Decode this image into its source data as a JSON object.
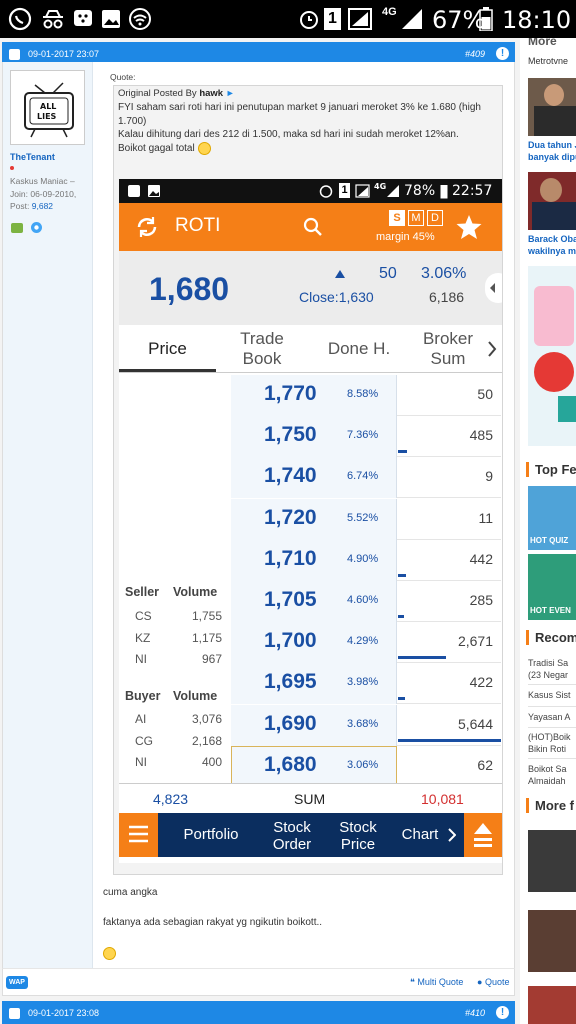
{
  "statusbar": {
    "battery_pct": "67%",
    "time": "18:10",
    "sim": "1",
    "net": "4G"
  },
  "post1": {
    "date": "09-01-2017 23:07",
    "number": "#409",
    "user": {
      "name": "TheTenant",
      "rank": "Kaskus Maniac",
      "join_label": "Join:",
      "join_date": "06-09-2010",
      "post_label": "Post:",
      "post_count": "9,682",
      "avatar_text_1": "ALL",
      "avatar_text_2": "LIES"
    },
    "quote_label": "Quote:",
    "quote_prefix": "Original Posted By",
    "quote_author": "hawk",
    "quote_lines": [
      "FYI saham sari roti hari ini penutupan market 9 januari meroket 3% ke 1.680 (high 1.700)",
      "Kalau dihitung dari des 212 di 1.500, maka sd hari ini sudah meroket 12%an.",
      "Boikot gagal total"
    ],
    "message_1": "cuma angka",
    "message_2": "faktanya ada sebagian rakyat yg ngikutin boikott..",
    "footer": {
      "multi_quote": "Multi Quote",
      "quote": "Quote",
      "wap": "WAP"
    }
  },
  "shot": {
    "status": {
      "sim": "1",
      "net": "4G",
      "battery": "78%",
      "time": "22:57"
    },
    "ticker": "ROTI",
    "period_tabs": [
      "S",
      "M",
      "D"
    ],
    "margin": "margin 45%",
    "last": "1,680",
    "change": "50",
    "change_pct": "3.06%",
    "close_label": "Close:",
    "close": "1,630",
    "volume": "6,186",
    "tabs": [
      {
        "line1": "Price",
        "line2": ""
      },
      {
        "line1": "Trade",
        "line2": "Book"
      },
      {
        "line1": "Done H.",
        "line2": ""
      },
      {
        "line1": "Broker",
        "line2": "Sum"
      }
    ],
    "orderbook": [
      {
        "price": "1,770",
        "pct": "8.58%",
        "vol": "50",
        "bar": 0.0
      },
      {
        "price": "1,750",
        "pct": "7.36%",
        "vol": "485",
        "bar": 0.09
      },
      {
        "price": "1,740",
        "pct": "6.74%",
        "vol": "9",
        "bar": 0.0
      },
      {
        "price": "1,720",
        "pct": "5.52%",
        "vol": "11",
        "bar": 0.0
      },
      {
        "price": "1,710",
        "pct": "4.90%",
        "vol": "442",
        "bar": 0.08
      },
      {
        "price": "1,705",
        "pct": "4.60%",
        "vol": "285",
        "bar": 0.05
      },
      {
        "price": "1,700",
        "pct": "4.29%",
        "vol": "2,671",
        "bar": 0.47
      },
      {
        "price": "1,695",
        "pct": "3.98%",
        "vol": "422",
        "bar": 0.07
      },
      {
        "price": "1,690",
        "pct": "3.68%",
        "vol": "5,644",
        "bar": 1.0
      },
      {
        "price": "1,680",
        "pct": "3.06%",
        "vol": "62",
        "bar": 0.0
      }
    ],
    "seller": {
      "header": [
        "Seller",
        "Volume"
      ],
      "rows": [
        [
          "CS",
          "1,755"
        ],
        [
          "KZ",
          "1,175"
        ],
        [
          "NI",
          "967"
        ]
      ]
    },
    "buyer": {
      "header": [
        "Buyer",
        "Volume"
      ],
      "rows": [
        [
          "AI",
          "3,076"
        ],
        [
          "CG",
          "2,168"
        ],
        [
          "NI",
          "400"
        ]
      ]
    },
    "sum": {
      "left": "4,823",
      "label": "SUM",
      "right": "10,081"
    },
    "bottom_nav": [
      {
        "line1": "Portfolio",
        "line2": ""
      },
      {
        "line1": "Stock",
        "line2": "Order"
      },
      {
        "line1": "Stock",
        "line2": "Price"
      },
      {
        "line1": "Chart",
        "line2": ""
      }
    ]
  },
  "post2": {
    "date": "09-01-2017 23:08",
    "number": "#410"
  },
  "sidebar": {
    "top_text": "More",
    "source": "Metrotvne",
    "items": [
      {
        "line1": "Dua tahun J",
        "line2": "banyak dipu"
      },
      {
        "line1": "Barack Obar",
        "line2": "wakilnya me"
      }
    ],
    "section_top": "Top Fe",
    "quiz_label": "HOT QUIZ",
    "event_label": "HOT EVEN",
    "section_recom": "Recom",
    "recom": [
      {
        "line1": "Tradisi Sa",
        "line2": "(23 Negar"
      },
      {
        "line1": "Kasus Sist",
        "line2": ""
      },
      {
        "line1": "Yayasan A",
        "line2": ""
      },
      {
        "line1": "(HOT)Boik",
        "line2": "Bikin Roti"
      },
      {
        "line1": "Boikot Sa",
        "line2": "Almaidah"
      }
    ],
    "section_more": "More f"
  }
}
